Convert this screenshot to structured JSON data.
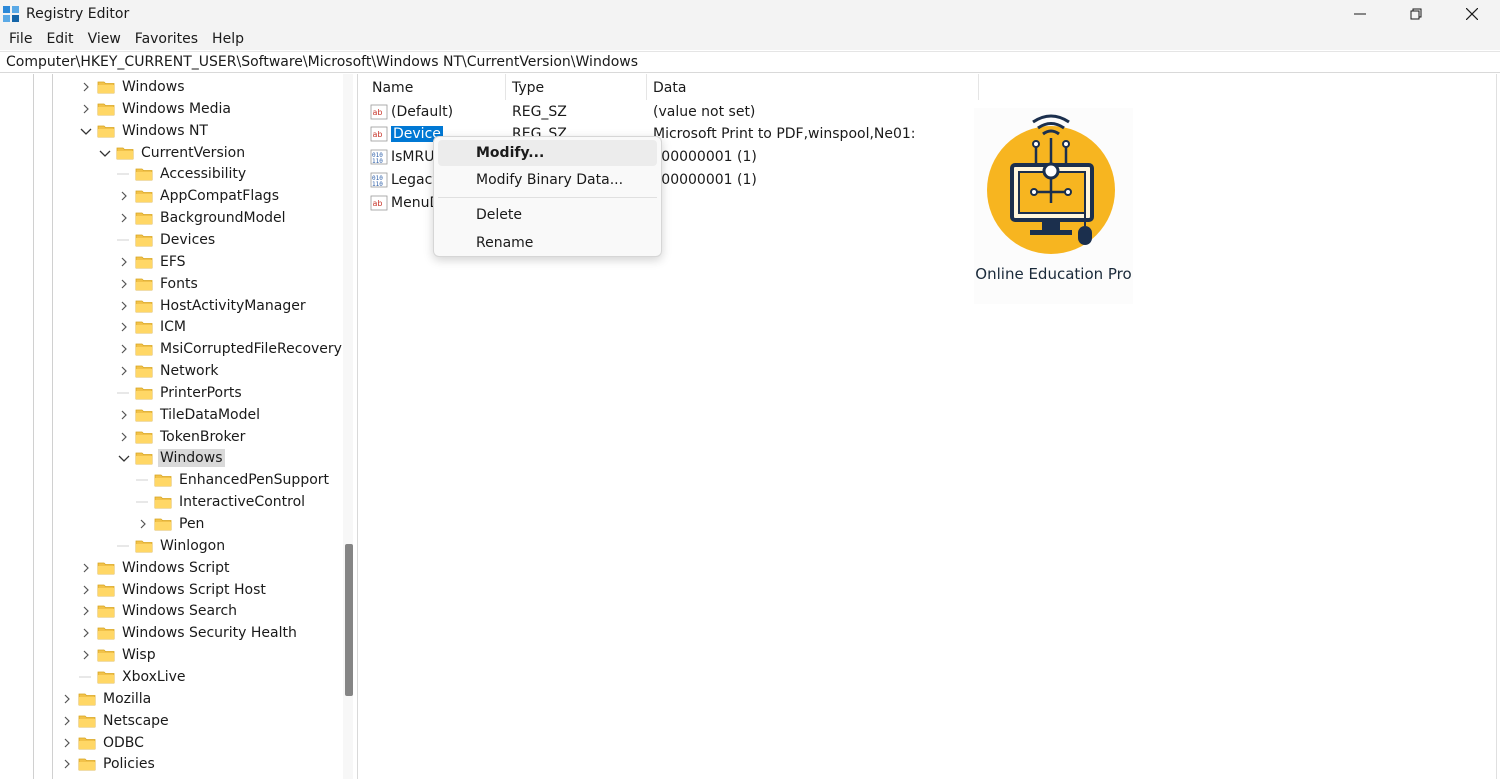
{
  "window": {
    "title": "Registry Editor",
    "icon": "registry-editor-icon",
    "controls": [
      "minimize-icon",
      "restore-icon",
      "close-icon"
    ]
  },
  "menu": {
    "items": [
      "File",
      "Edit",
      "View",
      "Favorites",
      "Help"
    ]
  },
  "address": {
    "path": "Computer\\HKEY_CURRENT_USER\\Software\\Microsoft\\Windows NT\\CurrentVersion\\Windows"
  },
  "tree": {
    "items": [
      {
        "label": "Windows",
        "depth": 0,
        "expander": "collapsed"
      },
      {
        "label": "Windows Media",
        "depth": 0,
        "expander": "collapsed"
      },
      {
        "label": "Windows NT",
        "depth": 0,
        "expander": "expanded"
      },
      {
        "label": "CurrentVersion",
        "depth": 1,
        "expander": "expanded"
      },
      {
        "label": "Accessibility",
        "depth": 2,
        "expander": "none"
      },
      {
        "label": "AppCompatFlags",
        "depth": 2,
        "expander": "collapsed"
      },
      {
        "label": "BackgroundModel",
        "depth": 2,
        "expander": "collapsed"
      },
      {
        "label": "Devices",
        "depth": 2,
        "expander": "none"
      },
      {
        "label": "EFS",
        "depth": 2,
        "expander": "collapsed"
      },
      {
        "label": "Fonts",
        "depth": 2,
        "expander": "collapsed"
      },
      {
        "label": "HostActivityManager",
        "depth": 2,
        "expander": "collapsed"
      },
      {
        "label": "ICM",
        "depth": 2,
        "expander": "collapsed"
      },
      {
        "label": "MsiCorruptedFileRecovery",
        "depth": 2,
        "expander": "collapsed"
      },
      {
        "label": "Network",
        "depth": 2,
        "expander": "collapsed"
      },
      {
        "label": "PrinterPorts",
        "depth": 2,
        "expander": "none"
      },
      {
        "label": "TileDataModel",
        "depth": 2,
        "expander": "collapsed"
      },
      {
        "label": "TokenBroker",
        "depth": 2,
        "expander": "collapsed"
      },
      {
        "label": "Windows",
        "depth": 2,
        "expander": "expanded",
        "selected": true
      },
      {
        "label": "EnhancedPenSupport",
        "depth": 3,
        "expander": "none"
      },
      {
        "label": "InteractiveControl",
        "depth": 3,
        "expander": "none"
      },
      {
        "label": "Pen",
        "depth": 3,
        "expander": "collapsed"
      },
      {
        "label": "Winlogon",
        "depth": 2,
        "expander": "none"
      },
      {
        "label": "Windows Script",
        "depth": 0,
        "expander": "collapsed"
      },
      {
        "label": "Windows Script Host",
        "depth": 0,
        "expander": "collapsed"
      },
      {
        "label": "Windows Search",
        "depth": 0,
        "expander": "collapsed"
      },
      {
        "label": "Windows Security Health",
        "depth": 0,
        "expander": "collapsed"
      },
      {
        "label": "Wisp",
        "depth": 0,
        "expander": "collapsed"
      },
      {
        "label": "XboxLive",
        "depth": 0,
        "expander": "none"
      },
      {
        "label": "Mozilla",
        "depth": -1,
        "expander": "collapsed"
      },
      {
        "label": "Netscape",
        "depth": -1,
        "expander": "collapsed"
      },
      {
        "label": "ODBC",
        "depth": -1,
        "expander": "collapsed"
      },
      {
        "label": "Policies",
        "depth": -1,
        "expander": "collapsed"
      }
    ]
  },
  "list": {
    "columns": [
      "Name",
      "Type",
      "Data"
    ],
    "rows": [
      {
        "name": "(Default)",
        "type": "REG_SZ",
        "data": "(value not set)",
        "icon": "string-value-icon"
      },
      {
        "name": "Device",
        "type": "REG_SZ",
        "data": "Microsoft Print to PDF,winspool,Ne01:",
        "icon": "string-value-icon",
        "selected": true
      },
      {
        "name": "IsMRU",
        "type": "",
        "data": "x00000001 (1)",
        "icon": "binary-value-icon"
      },
      {
        "name": "Legacy",
        "type": "",
        "data": "x00000001 (1)",
        "icon": "binary-value-icon"
      },
      {
        "name": "MenuD",
        "type": "",
        "data": "",
        "icon": "string-value-icon"
      }
    ]
  },
  "context_menu": {
    "items": [
      "Modify...",
      "Modify Binary Data...",
      "Delete",
      "Rename"
    ],
    "highlighted": "Modify..."
  },
  "logo": {
    "text": "Online Education Pro",
    "colors": {
      "circle": "#f7b520",
      "outline": "#1b2f4d"
    }
  },
  "colors": {
    "selection": "#0078d4",
    "folder": "#f2c24a",
    "chrome": "#f3f3f3"
  }
}
